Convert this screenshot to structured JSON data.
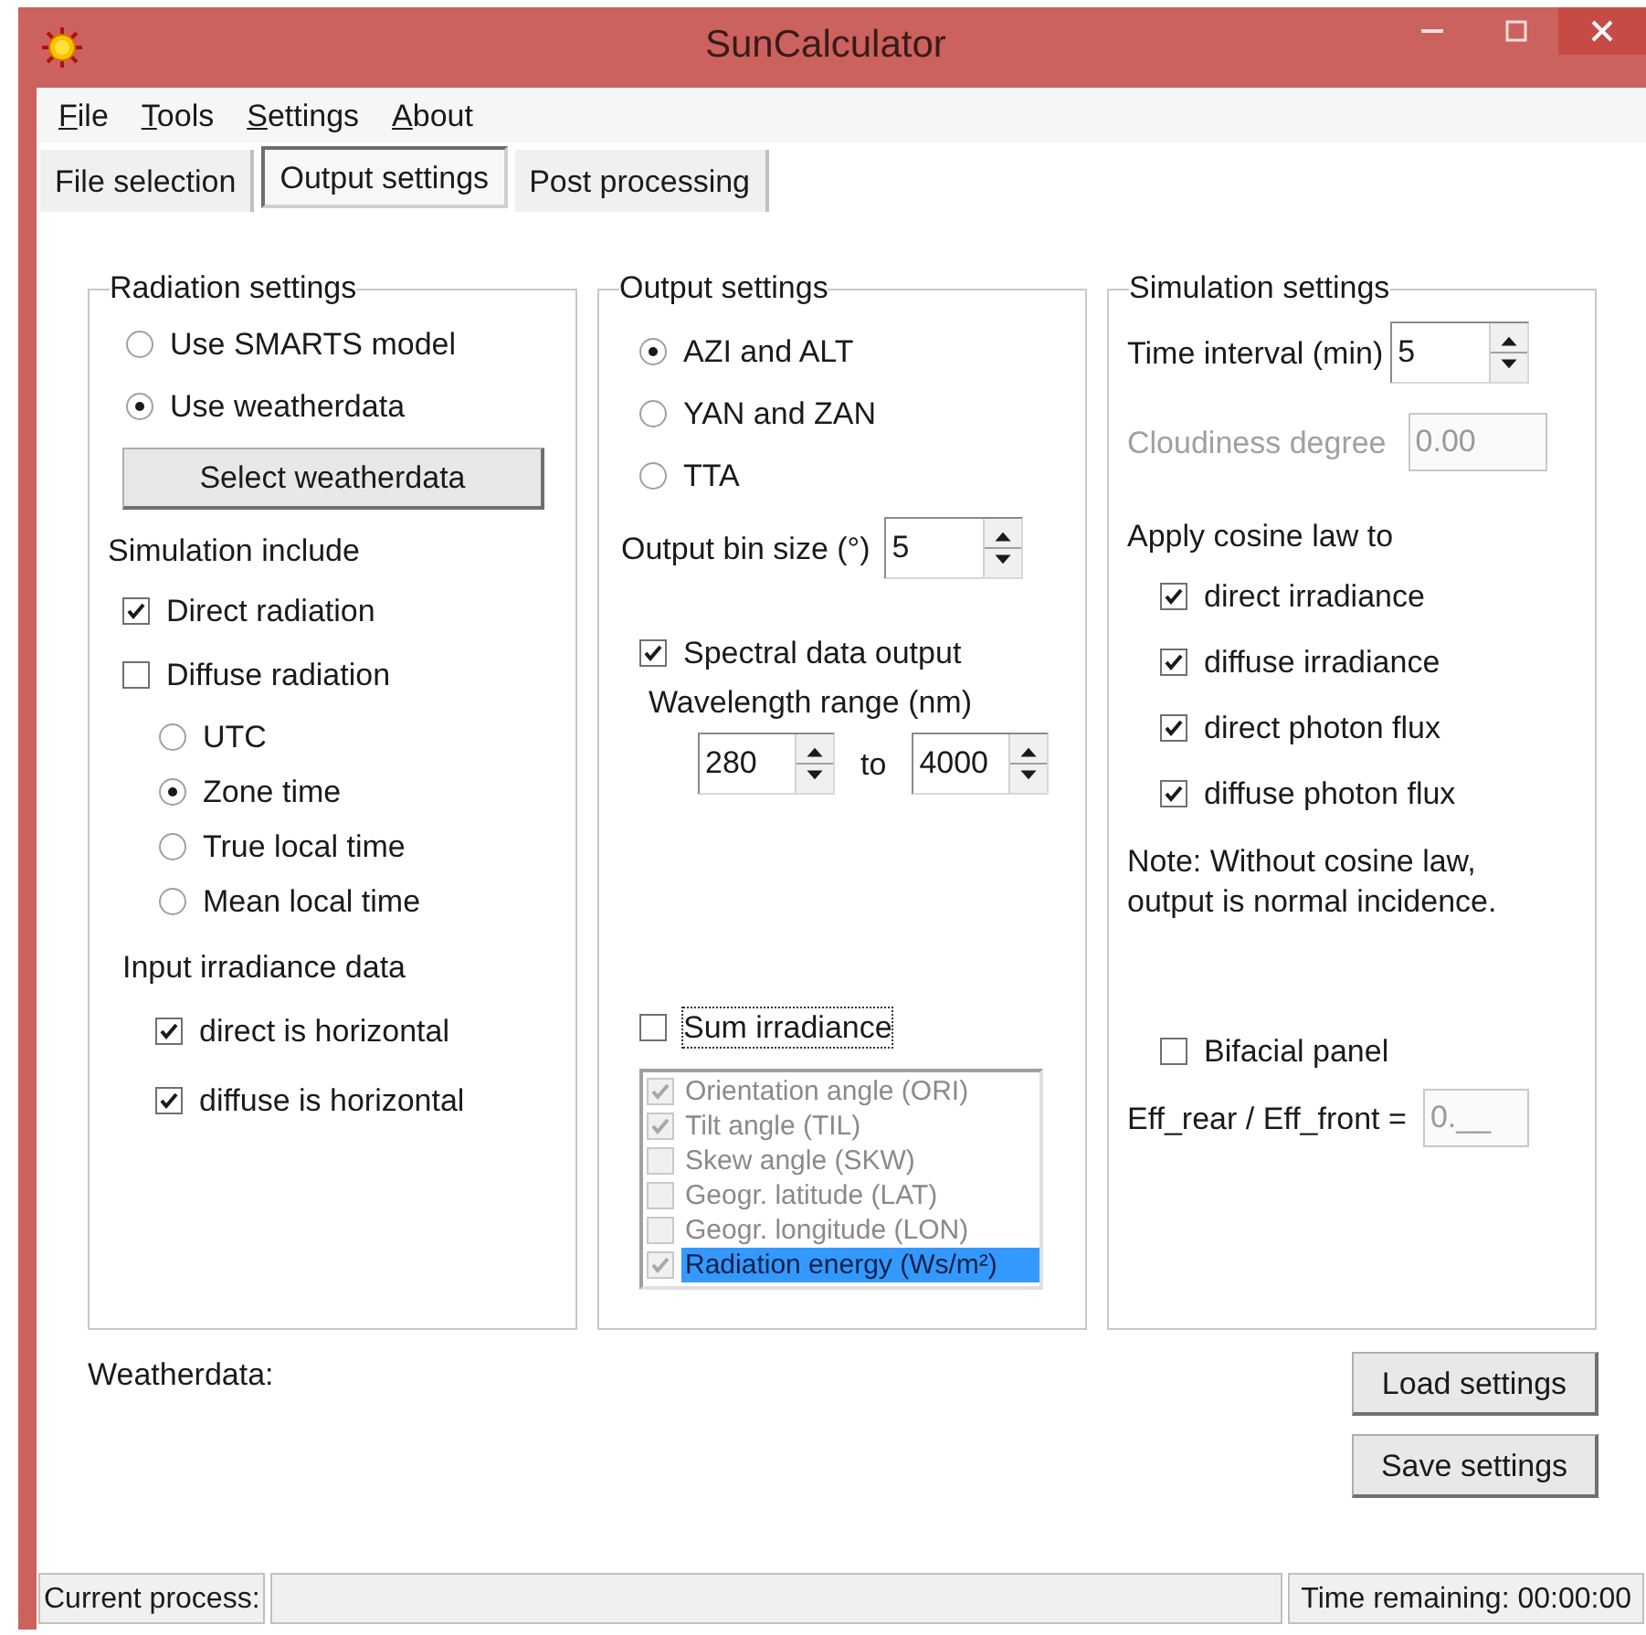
{
  "window": {
    "title": "SunCalculator"
  },
  "menu": [
    {
      "label": "File"
    },
    {
      "label": "Tools"
    },
    {
      "label": "Settings"
    },
    {
      "label": "About"
    }
  ],
  "tabs": [
    {
      "label": "File selection",
      "selected": false
    },
    {
      "label": "Output settings",
      "selected": true
    },
    {
      "label": "Post processing",
      "selected": false
    }
  ],
  "radiation_settings": {
    "title": "Radiation settings",
    "source": [
      {
        "label": "Use SMARTS model",
        "selected": false
      },
      {
        "label": "Use weatherdata",
        "selected": true
      }
    ],
    "select_button": "Select weatherdata",
    "simulation_include": {
      "label": "Simulation include",
      "checkboxes": [
        {
          "label": "Direct radiation",
          "checked": true
        },
        {
          "label": "Diffuse radiation",
          "checked": false
        }
      ],
      "time": [
        {
          "label": "UTC",
          "selected": false
        },
        {
          "label": "Zone time",
          "selected": true
        },
        {
          "label": "True local time",
          "selected": false
        },
        {
          "label": "Mean local time",
          "selected": false
        }
      ]
    },
    "input_irradiance": {
      "label": "Input irradiance data",
      "checkboxes": [
        {
          "label": "direct is horizontal",
          "checked": true
        },
        {
          "label": "diffuse is horizontal",
          "checked": true
        }
      ]
    }
  },
  "output_settings": {
    "title": "Output settings",
    "angles": [
      {
        "label": "AZI and ALT",
        "selected": true
      },
      {
        "label": "YAN and ZAN",
        "selected": false
      },
      {
        "label": "TTA",
        "selected": false
      }
    ],
    "bin_size": {
      "label": "Output bin size (°)",
      "value": "5"
    },
    "spectral": {
      "label": "Spectral data output",
      "checked": true
    },
    "wavelength": {
      "label": "Wavelength range (nm)",
      "from": "280",
      "separator": "to",
      "to": "4000"
    },
    "sum_irradiance": {
      "label": "Sum irradiance",
      "checked": false,
      "focused": true
    },
    "columns_list": {
      "disabled": true,
      "items": [
        {
          "label": "Orientation angle (ORI)",
          "checked": true,
          "selected": false
        },
        {
          "label": "Tilt angle (TIL)",
          "checked": true,
          "selected": false
        },
        {
          "label": "Skew angle (SKW)",
          "checked": false,
          "selected": false
        },
        {
          "label": "Geogr. latitude (LAT)",
          "checked": false,
          "selected": false
        },
        {
          "label": "Geogr. longitude (LON)",
          "checked": false,
          "selected": false
        },
        {
          "label": "Radiation energy (Ws/m²)",
          "checked": true,
          "selected": true
        }
      ]
    }
  },
  "simulation_settings": {
    "title": "Simulation settings",
    "time_interval": {
      "label": "Time interval (min)",
      "value": "5"
    },
    "cloudiness": {
      "label": "Cloudiness degree",
      "value": "0.00",
      "disabled": true
    },
    "cosine_law": {
      "label": "Apply cosine law to",
      "checkboxes": [
        {
          "label": "direct irradiance",
          "checked": true
        },
        {
          "label": "diffuse irradiance",
          "checked": true
        },
        {
          "label": "direct photon flux",
          "checked": true
        },
        {
          "label": "diffuse photon flux",
          "checked": true
        }
      ]
    },
    "note": "Note: Without cosine law,\noutput is normal incidence.",
    "bifacial": {
      "label": "Bifacial panel",
      "checked": false
    },
    "eff_ratio": {
      "label": "Eff_rear / Eff_front =",
      "value": "0.__",
      "disabled": true
    }
  },
  "weatherdata_label": "Weatherdata:",
  "buttons": [
    {
      "label": "Load settings"
    },
    {
      "label": "Save settings"
    }
  ],
  "status_bar": {
    "process_label": "Current process:",
    "progress": {
      "level": 0
    },
    "time_remaining": "Time remaining: 00:00:00"
  }
}
